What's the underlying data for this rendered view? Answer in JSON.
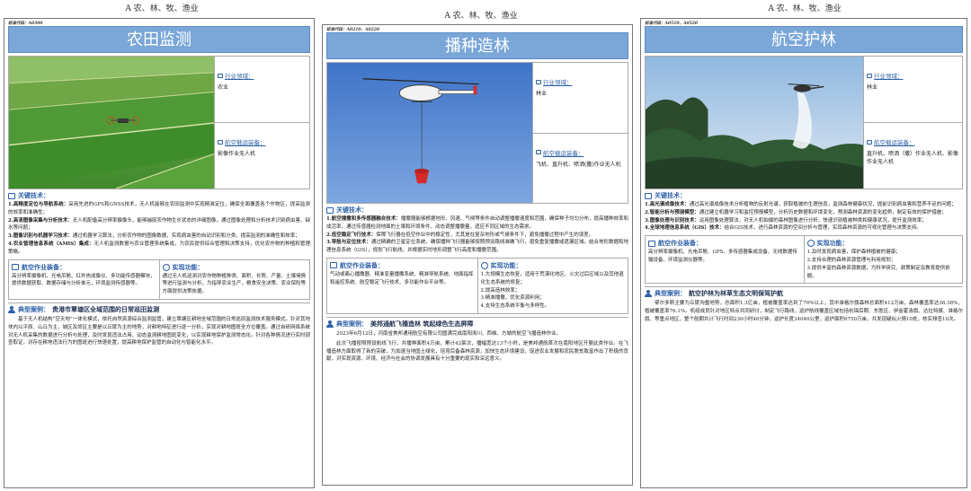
{
  "header": "A 农、林、牧、渔业",
  "labels": {
    "industry": "行业领域：",
    "equipment": "航空载运装备：",
    "tech": "关键技术：",
    "equip_section": "航空作业装备：",
    "function": "实现功能：",
    "case": "典型案例："
  },
  "cards": [
    {
      "code": "标准代码：A0300",
      "title": "农田监测",
      "industry": "农业",
      "equipment": "影像作业无人机",
      "tech": [
        {
          "name": "1.高精度定位与导航系统：",
          "text": "采用先进的GPS和GNSS技术，无人机能够在农田监测中实现精准定位，确保全面覆盖各个作物区，提高监测的效率和准确性；"
        },
        {
          "name": "2.高清图像采集与分析技术：",
          "text": "无人机配备高分辨率摄像头，能够捕捉农作物生长状态的详细图像，通过图像处理和分析技术识别病虫害、缺水等问题；"
        },
        {
          "name": "3.图像识别与机器学习技术：",
          "text": "通过机器学习算法，分析农作物的图像数据，实现病虫害的自动识别和分类，提高监测的准确性和效率；"
        },
        {
          "name": "4.农业管理信息系统（AMIS）集成：",
          "text": "无人机监测数据与农业管理系统集成，为农民提供综合管理和决策支持，优化农作物的种植和管理策略。"
        }
      ],
      "equip_text": "高分辨率摄像机、光电吊舱、红外热成像仪、多功能传感器模块，提供数据获取、数据存储与分析单元，环境监测传感器等。",
      "function_text": "通过无人机巡测对农作物种植种类、面积、长势、产量、土壤墒情等进行监测与分析，为指导农业生产，粮食安全决策、农业保险等方面提供决策依据。",
      "case_title": "贵港市覃塘区全域范围的日常巡田监测",
      "case_paras": [
        "基于无人机结构“空天地”一体化模式，依托自然资源综合监测监管，建立覃塘区耕地全域范围的日常巡田监测技术服务模式。针对其地块内以平原、山丘为主，城区及郊区主要是以丘陵为主的地势，对耕地特征进行逐一分析，实现对耕地图斑全方位覆盖。通过自研网络系统对无人机采集的数据进行分析与处理，及时发现违法占用、动态监测耕地图斑变化，以实现耕地保护监测常态化。针对各种情况进行实时调查取证，对存在耕地违法行为的图斑进行快速处置，提高耕地保护监管的自动化与智能化水平。"
      ]
    },
    {
      "code": "标准代码：A0210、A0220",
      "title": "播种造林",
      "industry": "林业",
      "equipment": "飞机、直升机、喷洒(撒)作业无人机",
      "tech": [
        {
          "name": "1.航空播撒和多传感器融合技术：",
          "text": "播撒器能够根据地形、风速、气候等条件自动调整播撒速度和范围，确保种子均匀分布，提高播种效率和成活率。通过传感器检测地面的土壤和环境条件，动态调整播撒量，适应不同区域的生态需求。"
        },
        {
          "name": "2.低空稳定飞行技术：",
          "text": "保障飞行器在低空作业中的稳定性，尤其是在复杂地形或气候条件下，避免播撒过程中产生的误差。"
        },
        {
          "name": "3.导航与定位技术：",
          "text": "通过精确的卫星定位系统，确保播种飞行器能够按照预设路线准确飞行，避免重复播撒或遗漏区域。结合地形数据和地理信息系统（GIS），规划飞行航线，并根据实时地形调整飞行高度和播撒范围。"
        }
      ],
      "equip_text": "气动或离心播撒器、精准变量播撒系统、精准导航系统、地面指挥和遥控系统、航空稳定飞行技术、多功能作业平台等。",
      "function_list": [
        "1.大规模生态恢复，适用于荒漠化地区、火灾过后区域以及其他退化生态系统的修复；",
        "2.提高造林效率；",
        "3.精准播撒，优化资源利用；",
        "4.支持生态系统平衡与多样性。"
      ],
      "case_title": "美邦通航飞播造林 筑起绿色生态屏障",
      "case_paras": [
        "2023年6月12日，河南省美邦通用航空有限公司圆满完成南阳淅川、西峡、方城的航空飞播造林作业。",
        "此次飞播按照预设航线飞行，共播种面积4万亩，累计42架次，播幅宽达13个小时，是美邦通航首次在南阳地区开展此类作业。在飞播造林方面取得了新的突破，为加速当地国土绿化，培育后备森林资源，加快生态环境建设，促进农业发展和农民脱贫致富作出了积极的贡献，对实现资源、环境、经济与社会的协调发展具有十分重要的现实和深远意义。"
      ]
    },
    {
      "code": "标准代码：A0510、A0520",
      "title": "航空护林",
      "industry": "林业",
      "equipment": "直升机、喷洒（撒）作业无人机、影像作业无人机",
      "tech": [
        {
          "name": "1.高光谱成像技术：",
          "text": "通过高光谱成像技术分析植物的反射光谱，获取植被的生理信息，监测森林健康状况，提前识别病虫害和营养不足的问题；"
        },
        {
          "name": "2.智能分析与预测模型：",
          "text": "通过建立机器学习和监控预报模型，分析历史数据和环境变化，预测森林资源的变化趋势，制定有效的保护措施；"
        },
        {
          "name": "3.图像处理与识别技术：",
          "text": "运用图像处理算法，对无人机拍摄的森林图像进行分析，快速识别植被种类和健康状况，提升监测效率；"
        },
        {
          "name": "4.全球地理信息系统（GIS）技术：",
          "text": "结合GIS技术，进行森林资源的空间分析与管理，实现森林资源的可视化管理与决策支持。"
        }
      ],
      "equip_text": "高分辨率摄像机、光电吊舱、GPS、多传感器集成设备、无线数据传输设备、环境监测仪器等。",
      "function_list": [
        "1.及时发现病虫害，保护森林植被的健康；",
        "2.支持合理的森林资源管理与利用规划；",
        "3.提供丰富的森林资源数据，为科学研究、政策制定及教育提供依据。"
      ],
      "case_title": "航空护林为林草生态文明保驾护航",
      "case_paras": [
        "鄂尔多斯主要为丘陵沟壑地势，总面积1.3亿亩，植被覆盖率达到了70%以上，其中准格尔旗森林总面积412万亩，森林覆盖率达36.38%，植被覆盖率76.1%。机组成员针对地区特点共同研讨，制定飞行路线，巡护航线覆盖区域包括杭锦后期、东胜区、伊金霍洛旗、达拉特旗、准格尔旗、等重点地区，整个航期共计飞行时间230小时40分钟，巡护长度34040公里，巡护面积6750万亩，共发现疑似火情10处，核实排查10次。"
      ]
    }
  ]
}
